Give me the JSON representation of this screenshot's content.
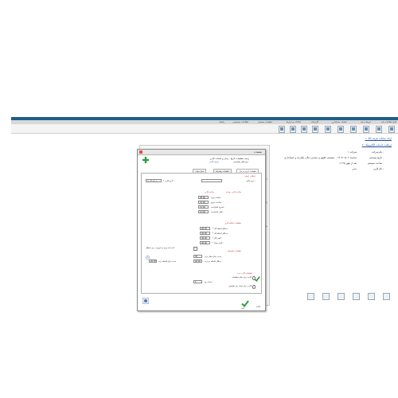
{
  "menubar": {
    "items": [
      "فایل اطلاعات پایه",
      "تعریفات پایه",
      "عملیات حسابداری",
      "گزارشات",
      "امکانات و ابزارها",
      "تنظیمات سیستم",
      "اطلاعات سیستمی",
      "راهنما"
    ]
  },
  "right_panel": {
    "link1": "۱- ارائه سامانه تعرفه کالا",
    "link2": "۲- دریافت خدمات الکترونیک",
    "info": [
      {
        "label": "نام شرکت :",
        "value": "شرکت ۱"
      },
      {
        "label": "تاریخ سیستم :",
        "value": "۱۴۰۲/۰۸/۰۶ (شنبه)"
      },
      {
        "label": "ساعت سیستم :",
        "value": "۱۱:۳۵ بعد از ظهر"
      },
      {
        "label": "نام کاربر :",
        "value": "مدیر"
      }
    ],
    "info_extra": "سیستم حقوق و دستمزد مالی یکپارچه و حسابداری"
  },
  "dialog": {
    "title": "تنظیمات",
    "header_text": "زمینه تنظیمات تاریخ ، زمان و انتخاب کاربر",
    "header_sub": "نوع فیلتر پیشفرض :",
    "header_link": "تعریف کاربر",
    "tabs": [
      "تنظیمات تاریخ و زمان",
      "تنظیمات پیشرفته",
      "سایر موارد"
    ],
    "section1": "عملیات اصلی",
    "date_label": "* تاریخ کاری :",
    "date_value": "۱۴۰۲/۰۸/۰۶",
    "period_label": "دوره مالی :",
    "period_value": "",
    "subsection_times": "ساعت کاری",
    "shift_header": "ساعت کاری روزانه",
    "rows": [
      {
        "label": "ساعت ورود :",
        "value": "08:00"
      },
      {
        "label": "ساعت خروج :",
        "value": "16:00"
      },
      {
        "label": "شروع استراحت :",
        "value": "12:00"
      },
      {
        "label": "پایان استراحت :",
        "value": "13:00"
      }
    ],
    "row_labels_extra": [
      "روزهای تعطیل",
      "پایان هفته",
      "شروع هفته"
    ],
    "subsection_overtime": "تنظیمات اضافه کاری",
    "ot_rows": [
      {
        "label": "* حداقل اضافه کار :",
        "value": "00:00"
      },
      {
        "label": "* حداکثر اضافه کار :",
        "value": "00:00"
      },
      {
        "label": "* کسر کار :",
        "value": "00:00"
      },
      {
        "label": "* تأخیر مجاز :",
        "value": "00:00"
      }
    ],
    "left_check_label": "عدم ثبت ورود و خروج در روز تعطیل",
    "red_label": "تنظیمات پیشرفته",
    "small_rows": [
      {
        "label": "مدت زمان مجاز تردد :",
        "value": "00"
      },
      {
        "label": "حداقل فاصله دو تردد :",
        "value": "00:00"
      }
    ],
    "left_small_label": "مدت زمان فاصله تردد",
    "section2": "تنظیمات کارت تردد",
    "radio1": "کارت برای تمام تنظیمات",
    "field_label": "تعداد روز :",
    "field_value": "5",
    "radio2": "کارت برای تعداد روز مشخص",
    "status": "آماده",
    "ok_label": "تأیید"
  },
  "colors": {
    "titlebar": "#1f5f8b",
    "ok": "#2e9d3a",
    "link": "#1d4f9c",
    "red": "#c62828"
  }
}
